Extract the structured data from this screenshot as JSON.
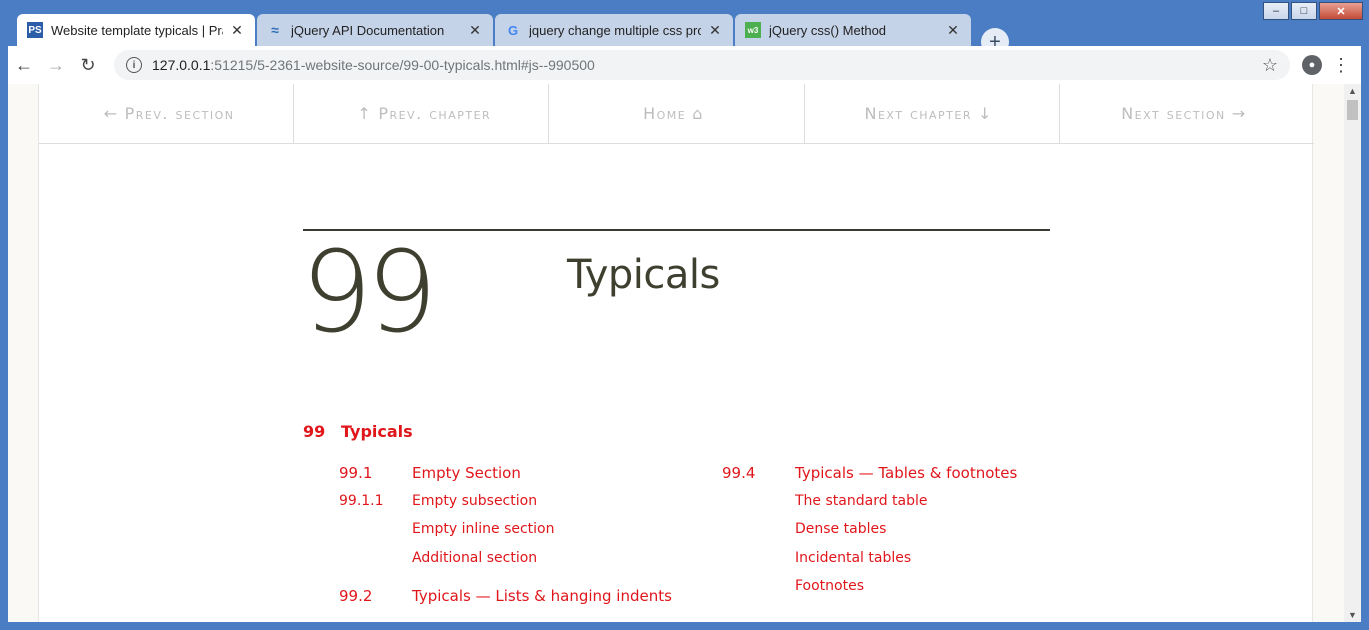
{
  "browser": {
    "tabs": [
      {
        "label": "Website template typicals | Practi",
        "icon": "ps-favicon-icon",
        "active": true
      },
      {
        "label": "jQuery API Documentation",
        "icon": "jquery-favicon-icon",
        "active": false
      },
      {
        "label": "jquery change multiple css prope",
        "icon": "google-favicon-icon",
        "active": false
      },
      {
        "label": "jQuery css() Method",
        "icon": "w3schools-favicon-icon",
        "active": false
      }
    ],
    "new_tab_label": "+",
    "url_host": "127.0.0.1",
    "url_path": ":51215/5-2361-website-source/99-00-typicals.html#js--990500"
  },
  "nav": {
    "prev_section": "Prev. section",
    "prev_chapter": "Prev. chapter",
    "home": "Home",
    "next_chapter": "Next chapter",
    "next_section": "Next section"
  },
  "chapter": {
    "number": "99",
    "title": "Typicals"
  },
  "toc": {
    "head_num": "99",
    "head_title": "Typicals",
    "left": [
      {
        "num": "99.1",
        "title": "Empty Section",
        "level": 1
      },
      {
        "num": "99.1.1",
        "title": "Empty subsection",
        "level": 2
      },
      {
        "num": "",
        "title": "Empty inline section",
        "level": 2
      },
      {
        "num": "",
        "title": "Additional section",
        "level": 2
      },
      {
        "num": "99.2",
        "title": "Typicals — Lists & hanging indents",
        "level": 1
      }
    ],
    "right": [
      {
        "num": "99.4",
        "title": "Typicals — Tables & footnotes",
        "level": 1
      },
      {
        "num": "",
        "title": "The standard table",
        "level": 2
      },
      {
        "num": "",
        "title": "Dense tables",
        "level": 2
      },
      {
        "num": "",
        "title": "Incidental tables",
        "level": 2
      },
      {
        "num": "",
        "title": "Footnotes",
        "level": 2
      }
    ]
  },
  "colors": {
    "link_red": "#e0161b",
    "text_dark": "#3f3f30",
    "nav_grey": "#bdbdbd"
  }
}
